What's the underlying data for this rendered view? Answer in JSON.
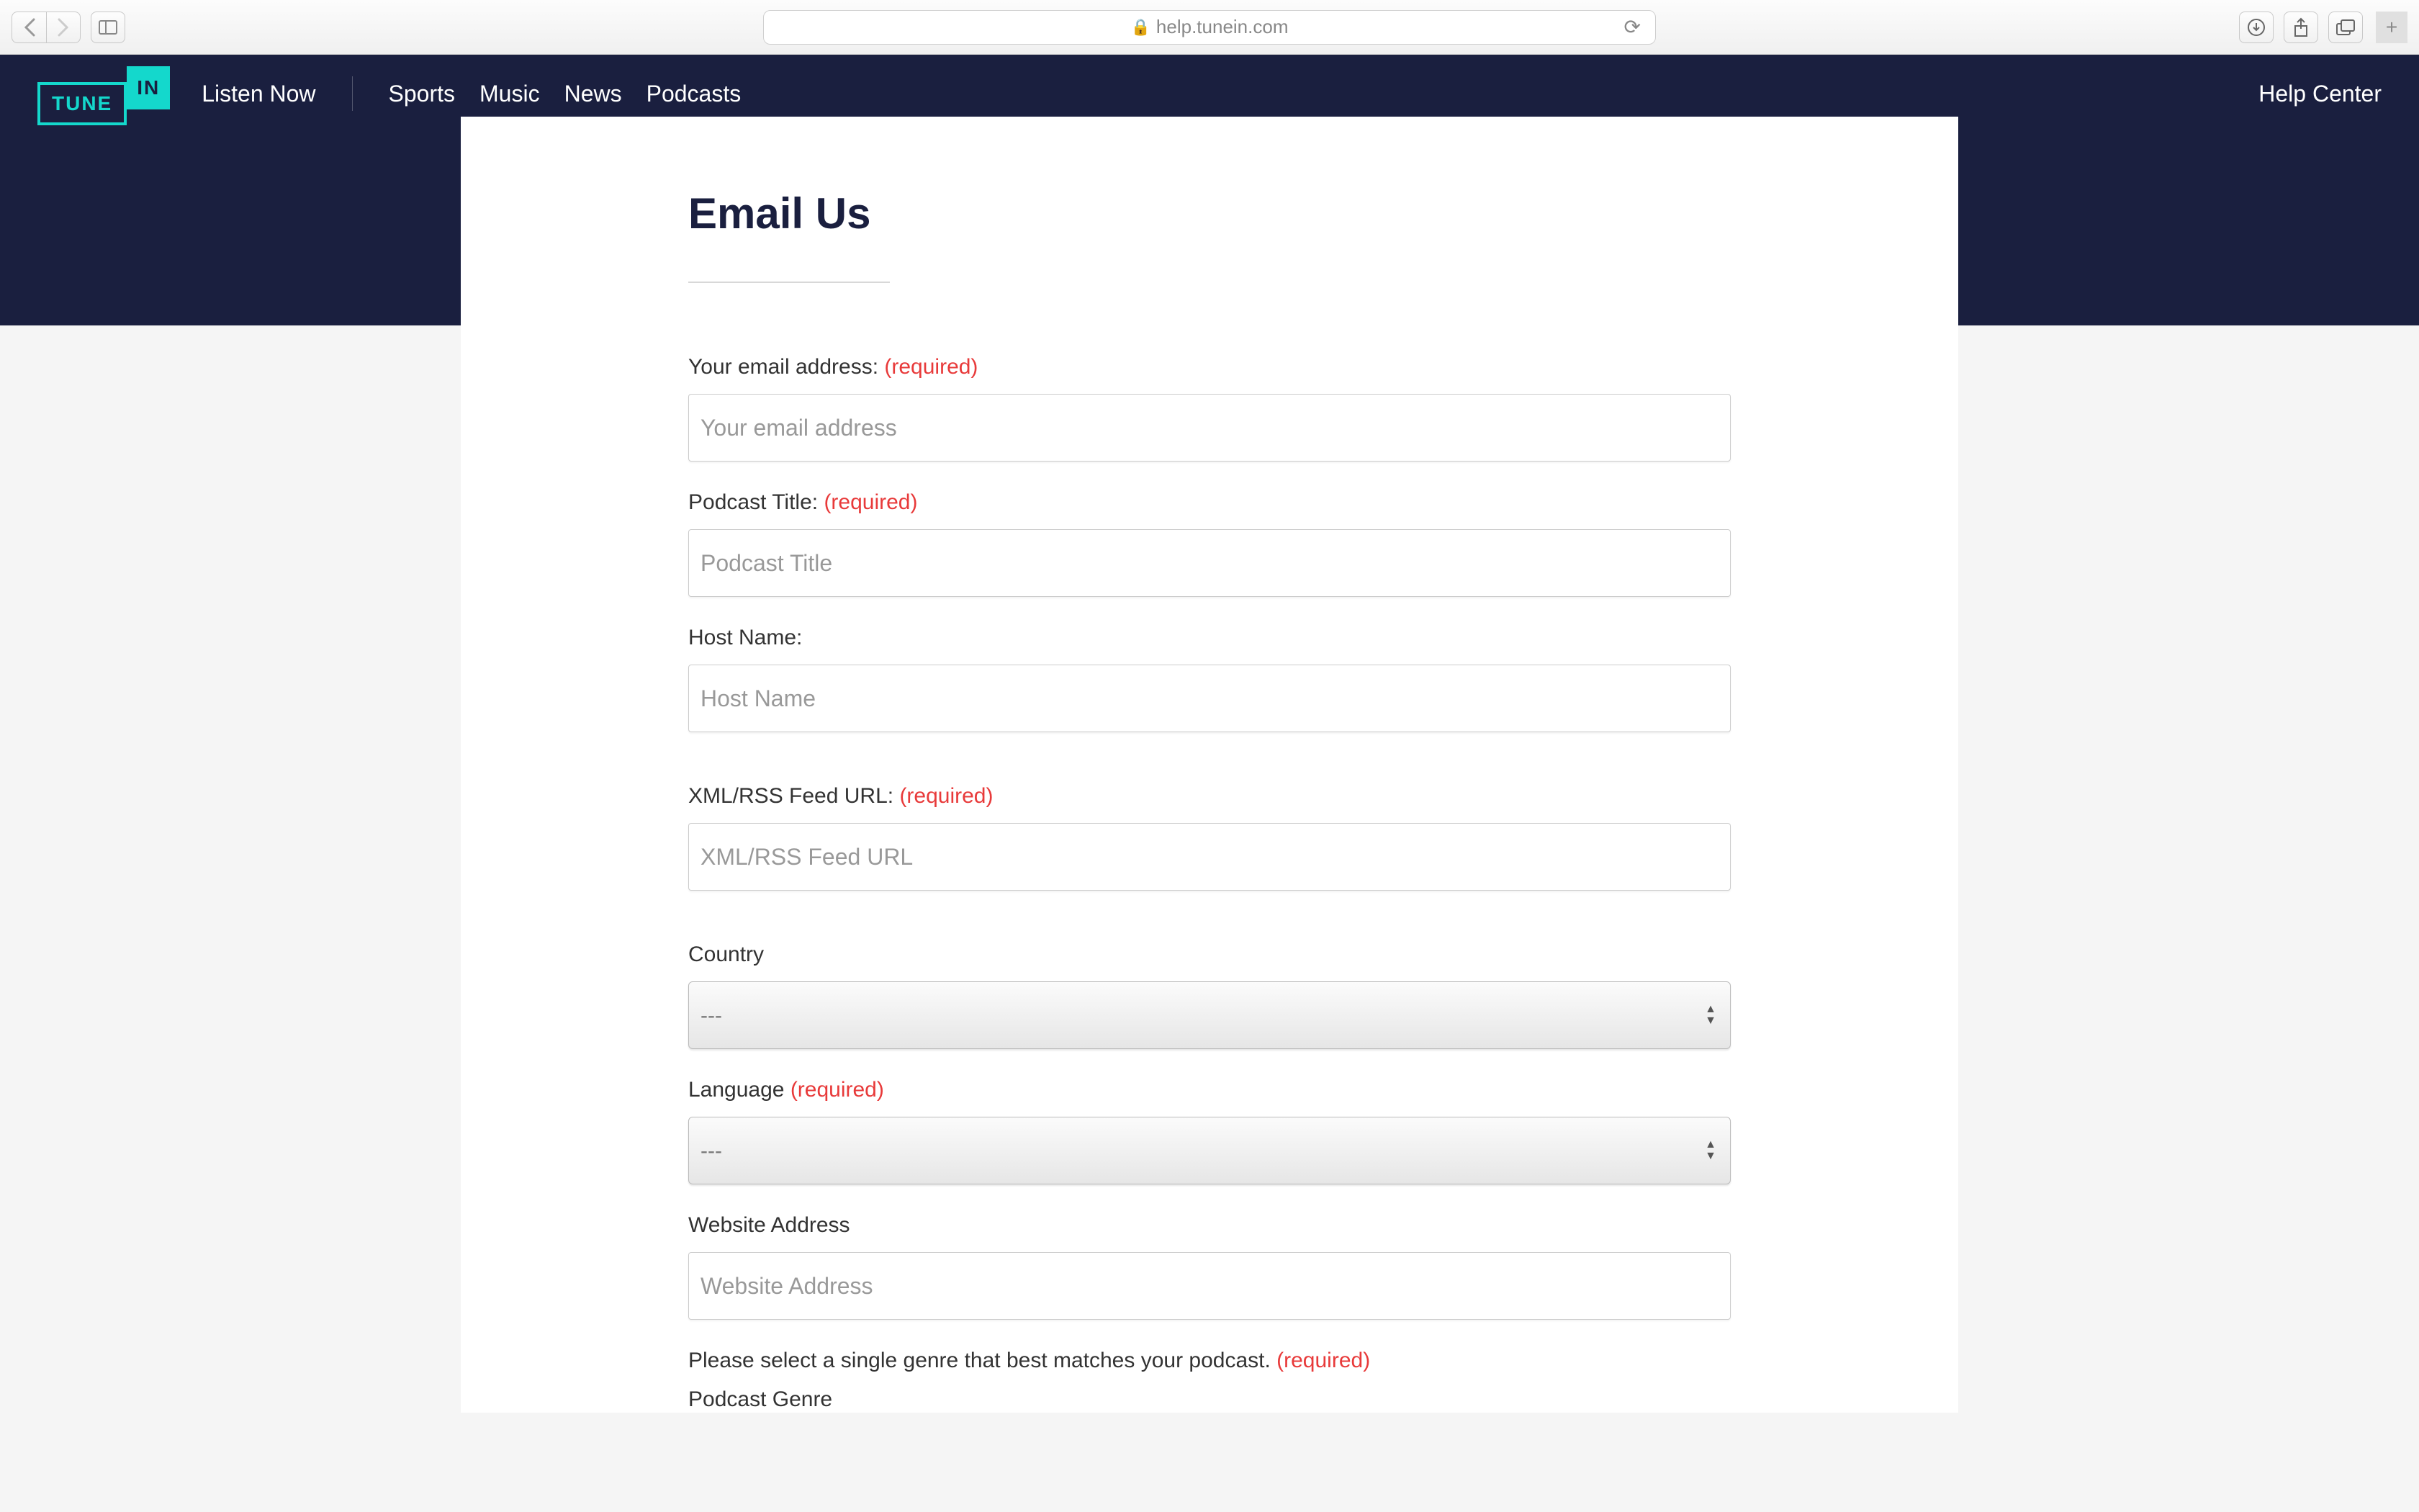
{
  "browser": {
    "url": "help.tunein.com"
  },
  "header": {
    "logo_left": "TUNE",
    "logo_right": "IN",
    "listen_now": "Listen Now",
    "nav_items": [
      "Sports",
      "Music",
      "News",
      "Podcasts"
    ],
    "help_center": "Help Center"
  },
  "form": {
    "title": "Email Us",
    "required_text": "(required)",
    "fields": {
      "email": {
        "label": "Your email address: ",
        "placeholder": "Your email address",
        "required": true
      },
      "podcast_title": {
        "label": "Podcast Title: ",
        "placeholder": "Podcast Title",
        "required": true
      },
      "host_name": {
        "label": "Host Name:",
        "placeholder": "Host Name",
        "required": false
      },
      "feed_url": {
        "label": "XML/RSS Feed URL: ",
        "placeholder": "XML/RSS Feed URL",
        "required": true
      },
      "country": {
        "label": "Country",
        "selected": "---",
        "required": false
      },
      "language": {
        "label": "Language ",
        "selected": "---",
        "required": true
      },
      "website": {
        "label": "Website Address",
        "placeholder": "Website Address",
        "required": false
      },
      "genre": {
        "label": "Please select a single genre that best matches your podcast. ",
        "sublabel": "Podcast Genre",
        "required": true
      }
    }
  }
}
